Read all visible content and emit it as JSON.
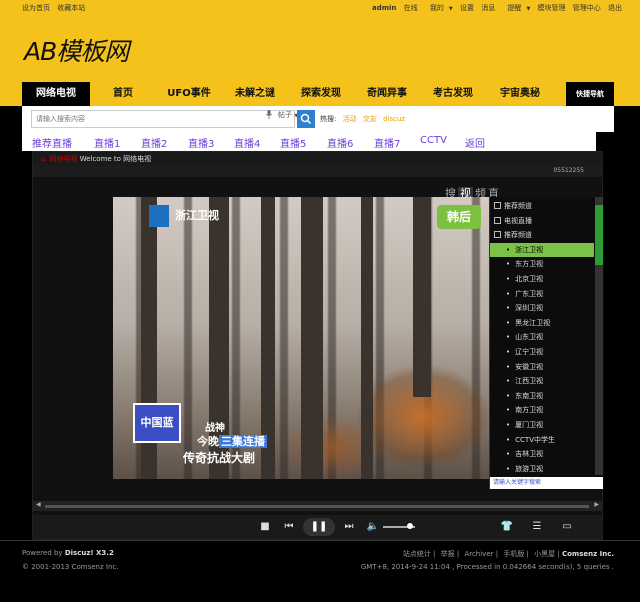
{
  "topbar": {
    "set_home": "设为首页",
    "bookmark": "收藏本站",
    "username": "admin",
    "status": "在线",
    "mine": "我的",
    "settings": "设置",
    "messages": "消息",
    "remind": "提醒",
    "module_admin": "模块管理",
    "admin_center": "管理中心",
    "logout": "退出"
  },
  "header": {
    "logo": "AB模板网"
  },
  "nav": {
    "items": [
      "网络电视",
      "首页",
      "UFO事件",
      "未解之谜",
      "探索发现",
      "奇闻异事",
      "考古发现",
      "宇宙奥秘"
    ],
    "active": "网络电视",
    "quick": "快捷导航"
  },
  "search": {
    "placeholder": "请输入搜索内容",
    "type": "帖子",
    "hot_label": "热搜:",
    "hot_keywords": [
      "活动",
      "交友",
      "discuz"
    ]
  },
  "channels": [
    "推荐直播",
    "直播1",
    "直播2",
    "直播3",
    "直播4",
    "直播5",
    "直播6",
    "直播7",
    "CCTV",
    "返回"
  ],
  "player": {
    "breadcrumb_red": "网络电视",
    "breadcrumb_text": "Welcome to 网络电视",
    "id_text": "05512255",
    "station_name": "浙江卫视",
    "corner_logo": "韩后",
    "caption_line1": "战神",
    "caption_line2_a": "今晚",
    "caption_line2_b": "三集连播",
    "caption_line3": "传奇抗战大剧",
    "badge_text": "中国蓝",
    "tabs": [
      "搜",
      "视",
      "频",
      "直"
    ],
    "tree": [
      {
        "label": "推荐频道",
        "level": 0,
        "box": true
      },
      {
        "label": "电视直播",
        "level": 0,
        "box": true
      },
      {
        "label": "推荐频道",
        "level": 1,
        "box": true
      },
      {
        "label": "浙江卫视",
        "level": 2,
        "selected": true
      },
      {
        "label": "东方卫视",
        "level": 2
      },
      {
        "label": "北京卫视",
        "level": 2
      },
      {
        "label": "广东卫视",
        "level": 2
      },
      {
        "label": "深圳卫视",
        "level": 2
      },
      {
        "label": "黑龙江卫视",
        "level": 2
      },
      {
        "label": "山东卫视",
        "level": 2
      },
      {
        "label": "辽宁卫视",
        "level": 2
      },
      {
        "label": "安徽卫视",
        "level": 2
      },
      {
        "label": "江西卫视",
        "level": 2
      },
      {
        "label": "东南卫视",
        "level": 2
      },
      {
        "label": "南方卫视",
        "level": 2
      },
      {
        "label": "厦门卫视",
        "level": 2
      },
      {
        "label": "CCTV中学生",
        "level": 2
      },
      {
        "label": "吉林卫视",
        "level": 2
      },
      {
        "label": "旅游卫视",
        "level": 2
      }
    ],
    "panel_search_placeholder": "请输入关键字搜索"
  },
  "footer": {
    "powered_prefix": "Powered by",
    "powered_name": "Discuz! X3.2",
    "copyright": "© 2001-2013 Comsenz Inc.",
    "links": [
      "站点统计",
      "举报",
      "Archiver",
      "手机版",
      "小黑屋"
    ],
    "company": "Comsenz Inc.",
    "stats": "GMT+8, 2014-9-24 11:04 , Processed in 0.042664 second(s), 5 queries ."
  }
}
